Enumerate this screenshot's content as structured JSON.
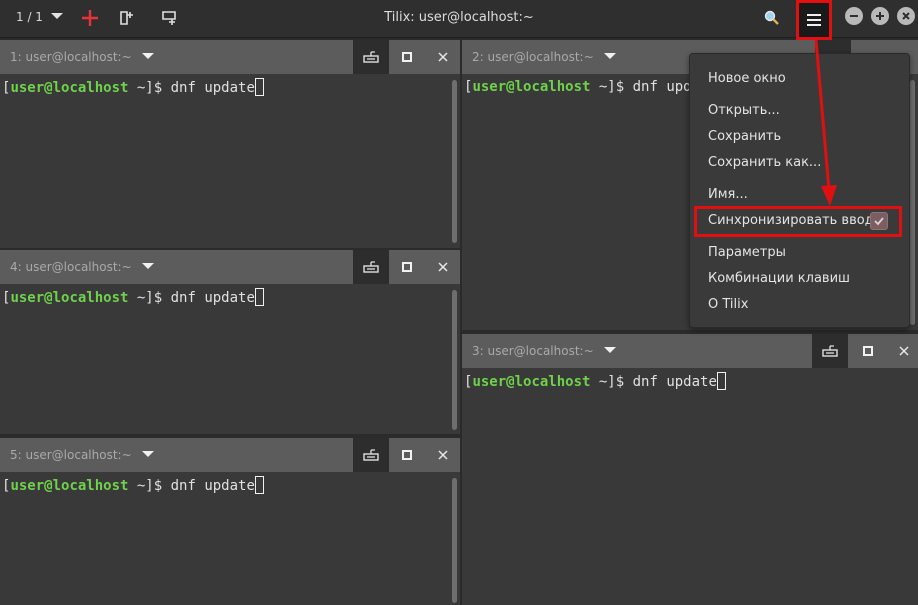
{
  "titlebar": {
    "session": "1 / 1",
    "title": "Tilix: user@localhost:~"
  },
  "panes": {
    "p1": {
      "title": "1: user@localhost:~",
      "prompt_user": "user@localhost",
      "prompt_rest": " ~]$ ",
      "command": "dnf update"
    },
    "p2": {
      "title": "2: user@localhost:~",
      "prompt_user": "user@localhost",
      "prompt_rest": " ~]$ ",
      "command": "dnf upd"
    },
    "p3": {
      "title": "3: user@localhost:~",
      "prompt_user": "user@localhost",
      "prompt_rest": " ~]$ ",
      "command": "dnf update"
    },
    "p4": {
      "title": "4: user@localhost:~",
      "prompt_user": "user@localhost",
      "prompt_rest": " ~]$ ",
      "command": "dnf update"
    },
    "p5": {
      "title": "5: user@localhost:~",
      "prompt_user": "user@localhost",
      "prompt_rest": " ~]$ ",
      "command": "dnf update"
    }
  },
  "menu": {
    "new_window": "Новое окно",
    "open": "Открыть...",
    "save": "Сохранить",
    "save_as": "Сохранить как...",
    "name": "Имя...",
    "sync_input": "Синхронизировать ввод",
    "sync_input_checked": true,
    "preferences": "Параметры",
    "shortcuts": "Комбинации клавиш",
    "about": "О Tilix"
  },
  "colors": {
    "accent_red": "#e01010",
    "prompt_green": "#6fd24b"
  }
}
